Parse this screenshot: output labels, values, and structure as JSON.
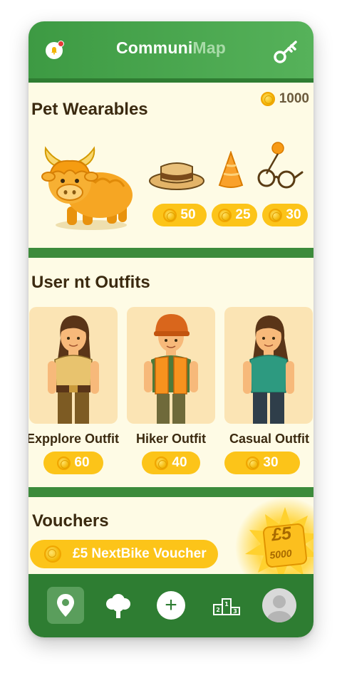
{
  "header": {
    "brand_primary": "Communi",
    "brand_secondary": "Map",
    "notification_icon": "bell-icon",
    "menu_icon": "key-icon"
  },
  "balance": {
    "amount": "1000"
  },
  "pet_wearables": {
    "title": "Pet Wearables",
    "items": [
      {
        "icon": "straw-hat-icon",
        "price": "50"
      },
      {
        "icon": "party-hat-icon",
        "price": "25"
      },
      {
        "icon": "glasses-icon",
        "price": "30"
      }
    ]
  },
  "user_outfits": {
    "title": "User nt Outfits",
    "items": [
      {
        "name": "Expplore Outfit",
        "price": "60"
      },
      {
        "name": "Hiker Outfit",
        "price": "40"
      },
      {
        "name": "Casual Outfit",
        "price": "30"
      }
    ]
  },
  "vouchers": {
    "title": "Vouchers",
    "voucher_label": "£5 NextBike Voucher",
    "badge_value": "£5",
    "badge_cost": "5000"
  },
  "bottom_nav": {
    "items": [
      "map-pin-icon",
      "tree-icon",
      "add-icon",
      "leaderboard-icon",
      "profile-icon"
    ],
    "add_symbol": "+"
  },
  "colors": {
    "header_green": "#4caf50",
    "nav_green": "#2e7d32",
    "accent_yellow": "#fcc419",
    "background_cream": "#fefbe5"
  }
}
